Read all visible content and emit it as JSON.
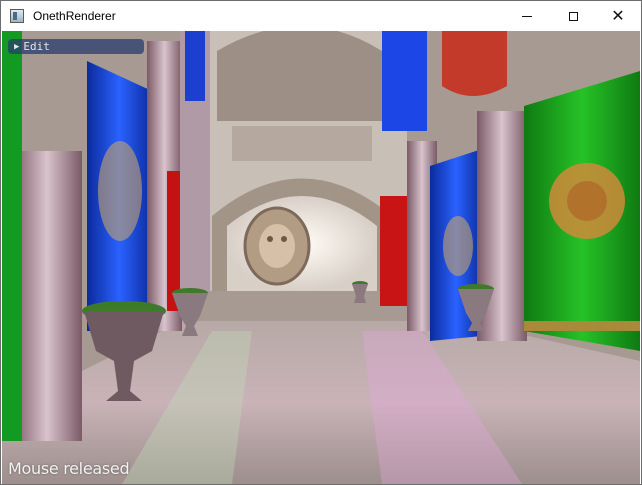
{
  "window": {
    "title": "OnethRenderer"
  },
  "titlebar_buttons": {
    "minimize_icon": "minimize-icon",
    "maximize_icon": "maximize-icon",
    "close_icon": "close-icon",
    "close_glyph": "✕"
  },
  "overlay": {
    "edit_label": "Edit",
    "edit_arrow": "▶",
    "status": "Mouse released"
  },
  "colors": {
    "titlebar_bg": "#ffffff",
    "panel_bg": "#283c6e",
    "curtain_blue": "#1d4fd8",
    "curtain_green": "#1fa31f",
    "curtain_red": "#c81414"
  }
}
